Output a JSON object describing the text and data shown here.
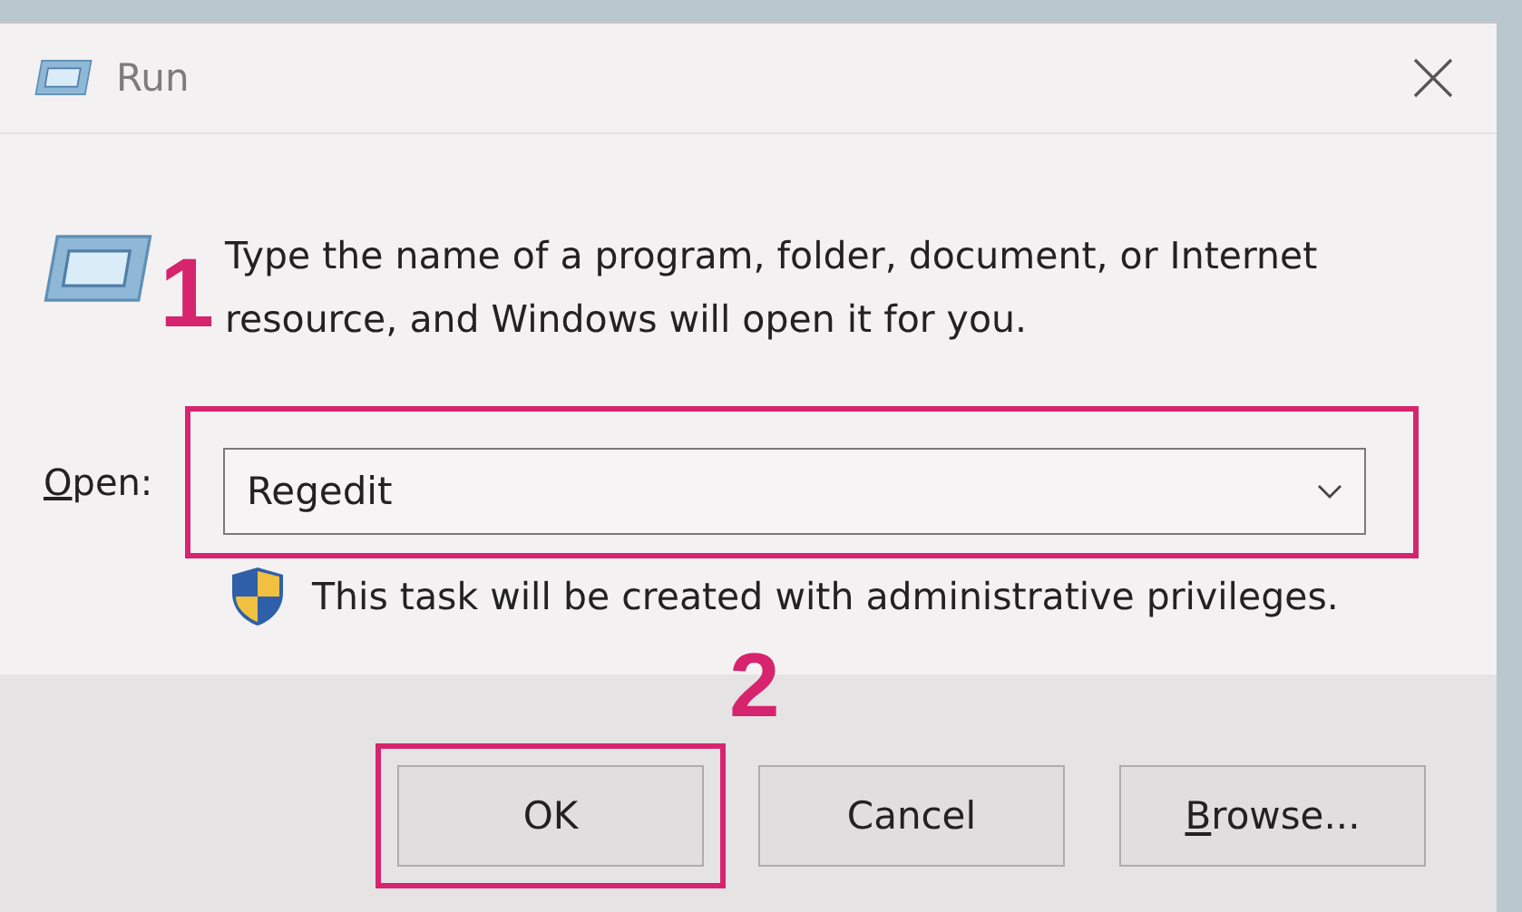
{
  "window": {
    "title": "Run"
  },
  "message": "Type the name of a program, folder, document, or Internet resource, and Windows will open it for you.",
  "open_field": {
    "label_key": "O",
    "label_rest": "pen:",
    "value": "Regedit",
    "highlighted": true
  },
  "admin_note": "This task will be created with administrative privileges.",
  "buttons": [
    {
      "label": "OK",
      "highlighted": true
    },
    {
      "label": "Cancel",
      "highlighted": false
    },
    {
      "key": "B",
      "label": "rowse...",
      "highlighted": false
    }
  ],
  "annotations": [
    {
      "text": "1"
    },
    {
      "text": "2"
    }
  ]
}
